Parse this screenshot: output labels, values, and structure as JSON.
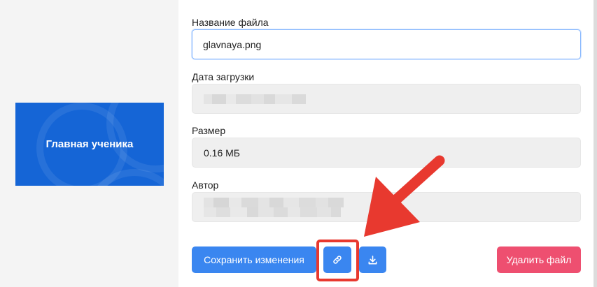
{
  "preview": {
    "title": "Главная ученика"
  },
  "form": {
    "filename_label": "Название файла",
    "filename_value": "glavnaya.png",
    "upload_date_label": "Дата загрузки",
    "size_label": "Размер",
    "size_value": "0.16 МБ",
    "author_label": "Автор"
  },
  "buttons": {
    "save_label": "Сохранить изменения",
    "delete_label": "Удалить файл"
  },
  "icons": {
    "link": "link-icon",
    "download": "download-icon"
  },
  "colors": {
    "primary": "#3a86f0",
    "danger": "#ee4f70",
    "preview_bg": "#1565d6",
    "annotation": "#e8392f"
  }
}
